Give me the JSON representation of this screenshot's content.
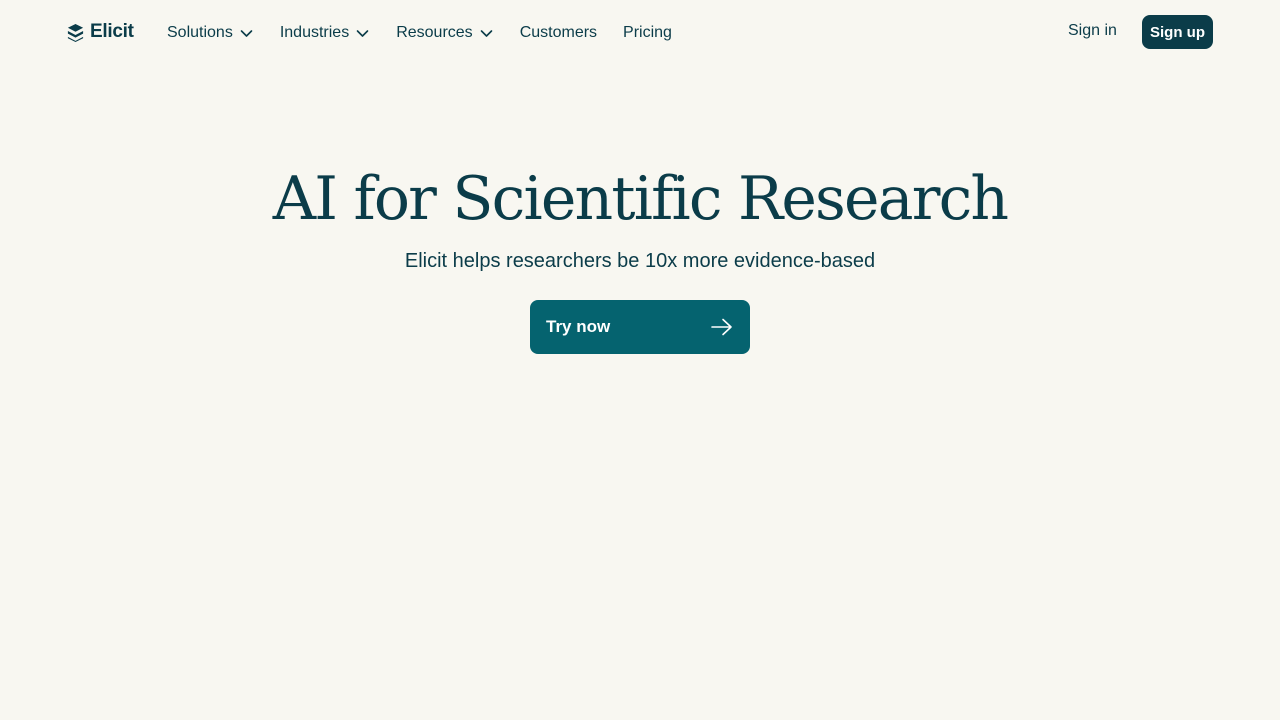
{
  "brand": {
    "name": "Elicit",
    "logo_icon": "elicit-logo-icon"
  },
  "nav": {
    "items": [
      {
        "label": "Solutions",
        "has_dropdown": true
      },
      {
        "label": "Industries",
        "has_dropdown": true
      },
      {
        "label": "Resources",
        "has_dropdown": true
      },
      {
        "label": "Customers",
        "has_dropdown": false
      },
      {
        "label": "Pricing",
        "has_dropdown": false
      }
    ],
    "sign_in": "Sign in",
    "sign_up": "Sign up"
  },
  "hero": {
    "title": "AI for Scientific Research",
    "subtitle": "Elicit helps researchers be 10x more evidence-based",
    "cta_label": "Try now",
    "cta_icon": "arrow-right-icon"
  },
  "colors": {
    "background": "#f8f7f1",
    "text": "#0b3c49",
    "primary_button": "#05636f",
    "signup_button": "#0b3c49"
  }
}
